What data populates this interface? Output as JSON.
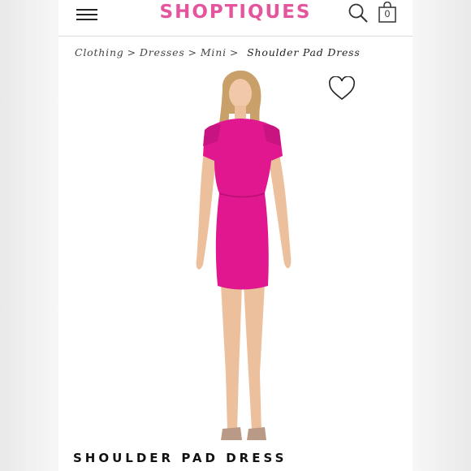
{
  "brand": {
    "name": "SHOPTIQUES",
    "color": "#e4559e"
  },
  "header": {
    "menu_icon": "hamburger-menu-icon",
    "search_icon": "search-icon",
    "bag_icon": "shopping-bag-icon",
    "bag_count": "0"
  },
  "breadcrumb": {
    "items": [
      "Clothing",
      "Dresses",
      "Mini"
    ],
    "separator": ">",
    "current": "Shoulder Pad Dress"
  },
  "product": {
    "title": "SHOULDER PAD DRESS",
    "wishlist_icon": "heart-outline-icon",
    "dress_color": "#e0178f"
  }
}
